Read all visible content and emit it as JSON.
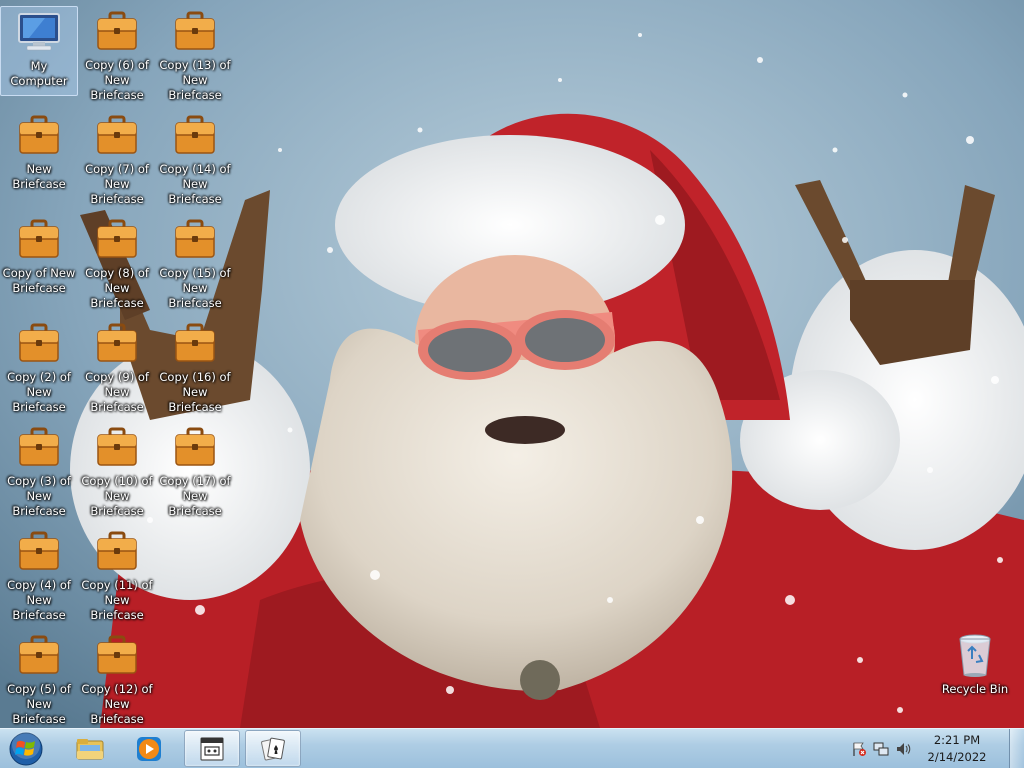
{
  "desktop": {
    "icons": [
      {
        "label": "My Computer",
        "icon": "my-computer-icon"
      },
      {
        "label": "New Briefcase",
        "icon": "briefcase-icon"
      },
      {
        "label": "Copy of New Briefcase",
        "icon": "briefcase-icon"
      },
      {
        "label": "Copy (2) of New Briefcase",
        "icon": "briefcase-icon"
      },
      {
        "label": "Copy (3) of New Briefcase",
        "icon": "briefcase-icon"
      },
      {
        "label": "Copy (4) of New Briefcase",
        "icon": "briefcase-icon"
      },
      {
        "label": "Copy (5) of New Briefcase",
        "icon": "briefcase-icon"
      },
      {
        "label": "Copy (6) of New Briefcase",
        "icon": "briefcase-icon"
      },
      {
        "label": "Copy (7) of New Briefcase",
        "icon": "briefcase-icon"
      },
      {
        "label": "Copy (8) of New Briefcase",
        "icon": "briefcase-icon"
      },
      {
        "label": "Copy (9) of New Briefcase",
        "icon": "briefcase-icon"
      },
      {
        "label": "Copy (10) of New Briefcase",
        "icon": "briefcase-icon"
      },
      {
        "label": "Copy (11) of New Briefcase",
        "icon": "briefcase-icon"
      },
      {
        "label": "Copy (12) of New Briefcase",
        "icon": "briefcase-icon"
      },
      {
        "label": "Copy (13) of New Briefcase",
        "icon": "briefcase-icon"
      },
      {
        "label": "Copy (14) of New Briefcase",
        "icon": "briefcase-icon"
      },
      {
        "label": "Copy (15) of New Briefcase",
        "icon": "briefcase-icon"
      },
      {
        "label": "Copy (16) of New Briefcase",
        "icon": "briefcase-icon"
      },
      {
        "label": "Copy (17) of New Briefcase",
        "icon": "briefcase-icon"
      },
      {
        "label": "Recycle Bin",
        "icon": "recycle-bin-icon"
      }
    ]
  },
  "taskbar": {
    "start": {
      "icon": "windows-start-icon"
    },
    "pinned": [
      {
        "icon": "windows-explorer-icon"
      },
      {
        "icon": "media-player-icon"
      },
      {
        "icon": "running-app-window-icon"
      },
      {
        "icon": "solitaire-cards-icon"
      }
    ],
    "tray": {
      "icons": [
        "action-center-flag-icon",
        "network-icon",
        "volume-icon"
      ],
      "time": "2:21 PM",
      "date": "2/14/2022"
    }
  },
  "colors": {
    "taskbar": "#9cc0dc",
    "briefcase": "#e08a1e",
    "santa_red": "#c0232a"
  }
}
